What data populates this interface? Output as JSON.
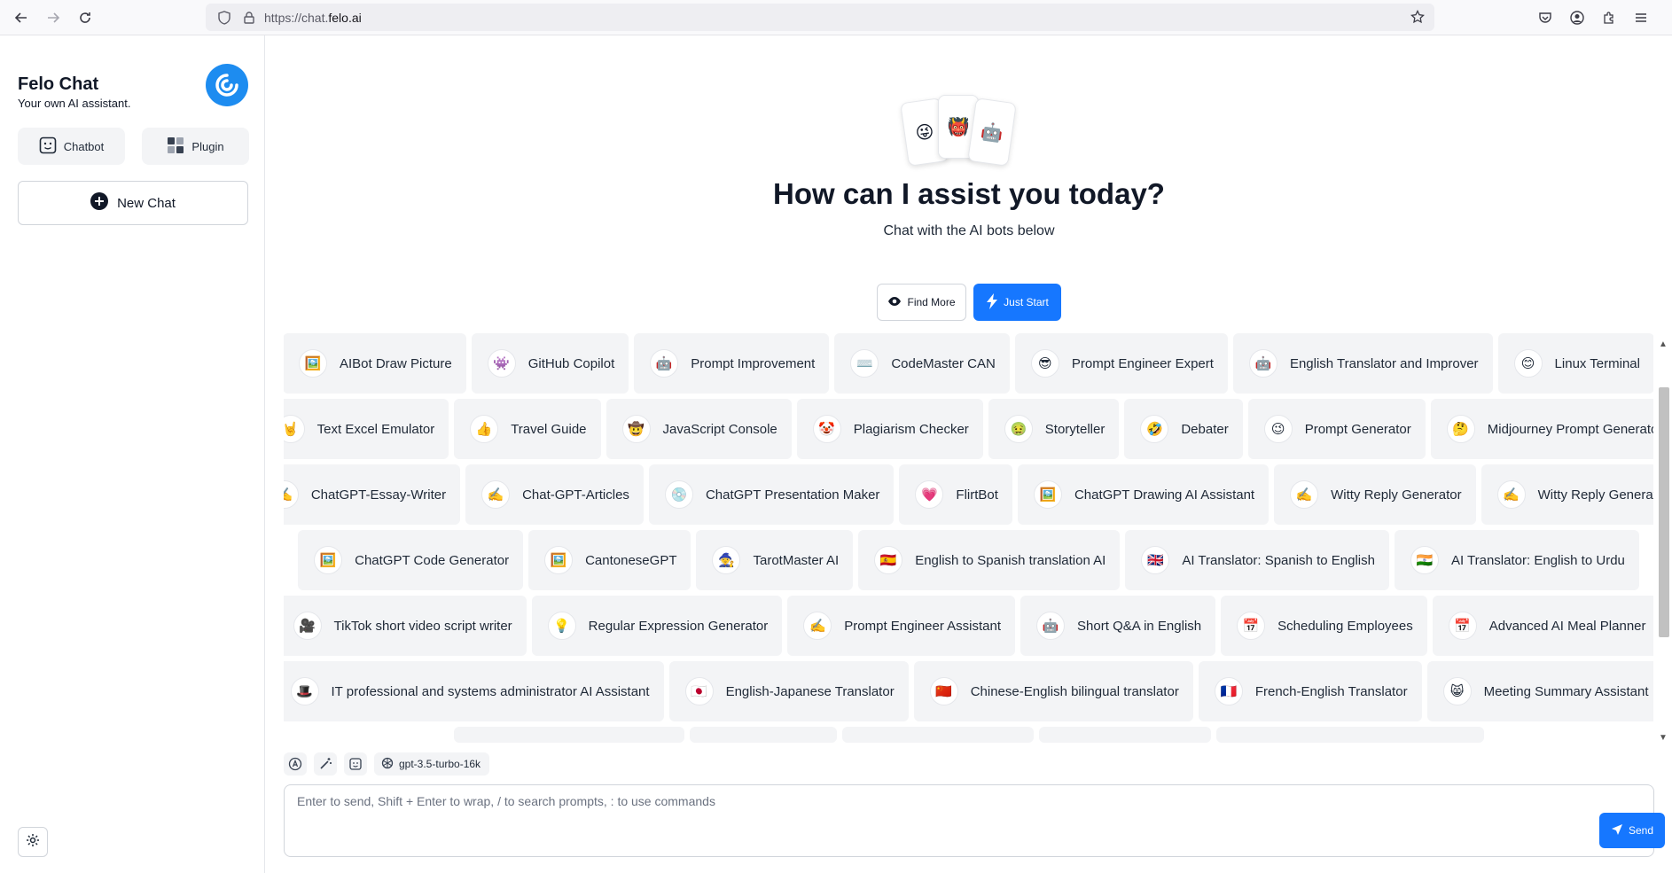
{
  "browser": {
    "url_prefix": "https://chat.",
    "url_domain": "felo.ai",
    "icons": [
      "back-arrow-icon",
      "forward-arrow-icon",
      "reload-icon",
      "shield-icon",
      "lock-icon",
      "bookmark-star-icon",
      "pocket-icon",
      "account-icon",
      "extensions-icon",
      "menu-icon"
    ]
  },
  "sidebar": {
    "title": "Felo Chat",
    "subtitle": "Your own AI assistant.",
    "tabs": [
      {
        "label": "Chatbot",
        "icon": "chatbot-icon"
      },
      {
        "label": "Plugin",
        "icon": "plugin-grid-icon"
      }
    ],
    "new_chat_label": "New Chat",
    "accent": "#1d8cf0"
  },
  "hero": {
    "emojis": [
      "😜",
      "👹",
      "🤖"
    ],
    "title": "How can I assist you today?",
    "subtitle": "Chat with the AI bots below",
    "find_more_label": "Find More",
    "just_start_label": "Just Start"
  },
  "bots": [
    [
      {
        "emoji": "🖼️",
        "name": "AIBot Draw Picture"
      },
      {
        "emoji": "👾",
        "name": "GitHub Copilot"
      },
      {
        "emoji": "🤖",
        "name": "Prompt Improvement"
      },
      {
        "emoji": "⌨️",
        "name": "CodeMaster CAN"
      },
      {
        "emoji": "😎",
        "name": "Prompt Engineer Expert"
      },
      {
        "emoji": "🤖",
        "name": "English Translator and Improver"
      },
      {
        "emoji": "😊",
        "name": "Linux Terminal"
      }
    ],
    [
      {
        "emoji": "🤘",
        "name": "Text Excel Emulator"
      },
      {
        "emoji": "👍",
        "name": "Travel Guide"
      },
      {
        "emoji": "🤠",
        "name": "JavaScript Console"
      },
      {
        "emoji": "🤡",
        "name": "Plagiarism Checker"
      },
      {
        "emoji": "🤢",
        "name": "Storyteller"
      },
      {
        "emoji": "🤣",
        "name": "Debater"
      },
      {
        "emoji": "😉",
        "name": "Prompt Generator"
      },
      {
        "emoji": "🤔",
        "name": "Midjourney Prompt Generator"
      }
    ],
    [
      {
        "emoji": "✍️",
        "name": "ChatGPT-Essay-Writer"
      },
      {
        "emoji": "✍️",
        "name": "Chat-GPT-Articles"
      },
      {
        "emoji": "💿",
        "name": "ChatGPT Presentation Maker"
      },
      {
        "emoji": "💗",
        "name": "FlirtBot"
      },
      {
        "emoji": "🖼️",
        "name": "ChatGPT Drawing AI Assistant"
      },
      {
        "emoji": "✍️",
        "name": "Witty Reply Generator"
      },
      {
        "emoji": "✍️",
        "name": "Witty Reply Generator"
      }
    ],
    [
      {
        "emoji": "🖼️",
        "name": "ChatGPT Code Generator"
      },
      {
        "emoji": "🖼️",
        "name": "CantoneseGPT"
      },
      {
        "emoji": "🧙",
        "name": "TarotMaster AI"
      },
      {
        "emoji": "🇪🇸",
        "name": "English to Spanish translation AI"
      },
      {
        "emoji": "🇬🇧",
        "name": "AI Translator: Spanish to English"
      },
      {
        "emoji": "🇮🇳",
        "name": "AI Translator: English to Urdu"
      }
    ],
    [
      {
        "emoji": "🎥",
        "name": "TikTok short video script writer"
      },
      {
        "emoji": "💡",
        "name": "Regular Expression Generator"
      },
      {
        "emoji": "✍️",
        "name": "Prompt Engineer Assistant"
      },
      {
        "emoji": "🤖",
        "name": "Short Q&A in English"
      },
      {
        "emoji": "📅",
        "name": "Scheduling Employees"
      },
      {
        "emoji": "📅",
        "name": "Advanced AI Meal Planner"
      }
    ],
    [
      {
        "emoji": "🎩",
        "name": "IT professional and systems administrator AI Assistant"
      },
      {
        "emoji": "🇯🇵",
        "name": "English-Japanese Translator"
      },
      {
        "emoji": "🇨🇳",
        "name": "Chinese-English bilingual translator"
      },
      {
        "emoji": "🇫🇷",
        "name": "French-English Translator"
      },
      {
        "emoji": "😸",
        "name": "Meeting Summary Assistant"
      }
    ]
  ],
  "composer": {
    "tool_icons": [
      "auto-icon",
      "magic-wand-icon",
      "bot-face-icon"
    ],
    "model": "gpt-3.5-turbo-16k",
    "placeholder": "Enter to send, Shift + Enter to wrap, / to search prompts, : to use commands",
    "send_label": "Send"
  },
  "colors": {
    "primary": "#1677ff",
    "chip_bg": "#f3f4f6"
  }
}
